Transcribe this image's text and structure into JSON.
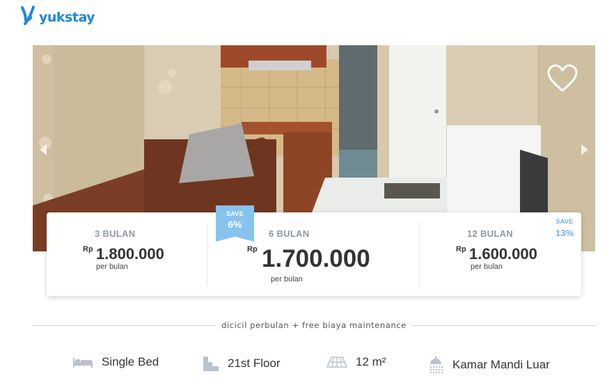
{
  "brand": {
    "name": "yukstay",
    "color": "#1e88d8"
  },
  "gallery": {
    "favorite_icon": "heart-outline-icon",
    "prev_icon": "chevron-left-icon",
    "next_icon": "chevron-right-icon"
  },
  "pricing": {
    "currency": "Rp",
    "plans": [
      {
        "duration": "3 BULAN",
        "price": "1.800.000",
        "unit": "per bulan"
      },
      {
        "duration": "6 BULAN",
        "price": "1.700.000",
        "unit": "per bulan",
        "save_label": "SAVE",
        "save_value": "6%"
      },
      {
        "duration": "12 BULAN",
        "price": "1.600.000",
        "unit": "per bulan",
        "save_label": "SAVE",
        "save_value": "13%"
      }
    ],
    "accent_color": "#86c4ef"
  },
  "divider_text": "dicicil perbulan + free biaya maintenance",
  "features": [
    {
      "icon": "bed-icon",
      "label": "Single Bed"
    },
    {
      "icon": "building-floor-icon",
      "label": "21st Floor"
    },
    {
      "icon": "floor-area-icon",
      "label": "12 m²"
    },
    {
      "icon": "shower-icon",
      "label": "Kamar Mandi Luar"
    }
  ]
}
